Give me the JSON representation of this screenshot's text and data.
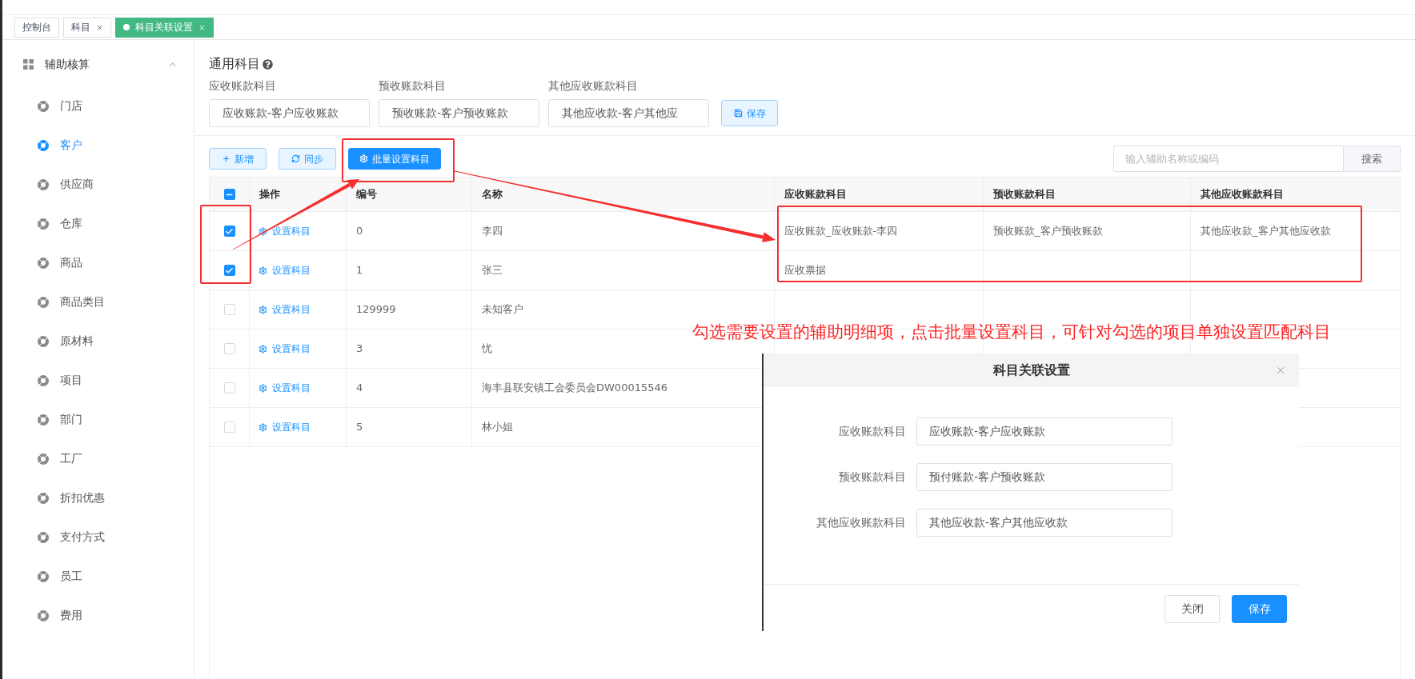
{
  "tabs": [
    {
      "label": "控制台",
      "closable": false,
      "selected": false
    },
    {
      "label": "科目",
      "closable": true,
      "selected": false
    },
    {
      "label": "科目关联设置",
      "closable": true,
      "selected": true
    }
  ],
  "sidebar": {
    "group": {
      "label": "辅助核算",
      "expanded": true
    },
    "items": [
      {
        "label": "门店",
        "selected": false
      },
      {
        "label": "客户",
        "selected": true
      },
      {
        "label": "供应商",
        "selected": false
      },
      {
        "label": "仓库",
        "selected": false
      },
      {
        "label": "商品",
        "selected": false
      },
      {
        "label": "商品类目",
        "selected": false
      },
      {
        "label": "原材料",
        "selected": false
      },
      {
        "label": "项目",
        "selected": false
      },
      {
        "label": "部门",
        "selected": false
      },
      {
        "label": "工厂",
        "selected": false
      },
      {
        "label": "折扣优惠",
        "selected": false
      },
      {
        "label": "支付方式",
        "selected": false
      },
      {
        "label": "员工",
        "selected": false
      },
      {
        "label": "费用",
        "selected": false
      }
    ]
  },
  "general_accounts": {
    "title": "通用科目",
    "fields": [
      {
        "label": "应收账款科目",
        "value": "应收账款-客户应收账款"
      },
      {
        "label": "预收账款科目",
        "value": "预收账款-客户预收账款"
      },
      {
        "label": "其他应收账款科目",
        "value": "其他应收款-客户其他应"
      }
    ],
    "save_button": "保存"
  },
  "toolbar": {
    "buttons": [
      {
        "label": "新增",
        "kind": "add"
      },
      {
        "label": "同步",
        "kind": "sync"
      },
      {
        "label": "批量设置科目",
        "kind": "batch"
      }
    ],
    "search": {
      "placeholder": "输入辅助名称或编码",
      "button": "搜索"
    }
  },
  "table": {
    "select_all": {
      "indeterminate": true
    },
    "columns": [
      "操作",
      "编号",
      "名称",
      "应收账款科目",
      "预收账款科目",
      "其他应收账款科目"
    ],
    "rows": [
      {
        "checked": true,
        "action": "设置科目",
        "code": "0",
        "name": "李四",
        "receivable": "应收账款_应收账款-李四",
        "advance": "预收账款_客户预收账款",
        "other": "其他应收款_客户其他应收款"
      },
      {
        "checked": true,
        "action": "设置科目",
        "code": "1",
        "name": "张三",
        "receivable": "应收票据"
      },
      {
        "checked": false,
        "action": "设置科目",
        "code": "129999",
        "name": "未知客户"
      },
      {
        "checked": false,
        "action": "设置科目",
        "code": "3",
        "name": "忧"
      },
      {
        "checked": false,
        "action": "设置科目",
        "code": "4",
        "name": "海丰县联安镇工会委员会DW00015546"
      },
      {
        "checked": false,
        "action": "设置科目",
        "code": "5",
        "name": "林小姐"
      }
    ]
  },
  "annotation": {
    "note": "勾选需要设置的辅助明细项，点击批量设置科目，可针对勾选的项目单独设置匹配科目"
  },
  "dialog": {
    "title": "科目关联设置",
    "fields": [
      {
        "label": "应收账款科目",
        "value": "应收账款-客户应收账款"
      },
      {
        "label": "预收账款科目",
        "value": "预付账款-客户预收账款"
      },
      {
        "label": "其他应收账款科目",
        "value": "其他应收款-客户其他应收款"
      }
    ],
    "buttons": [
      {
        "label": "关闭",
        "kind": "secondary"
      },
      {
        "label": "保存",
        "kind": "primary"
      }
    ]
  }
}
